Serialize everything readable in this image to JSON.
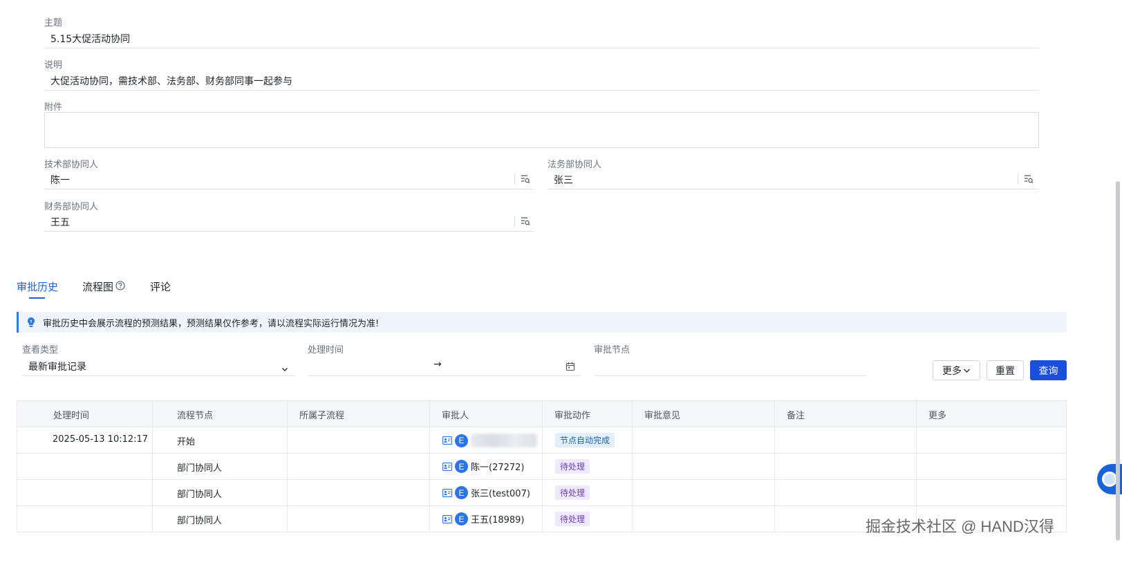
{
  "form": {
    "subject": {
      "label": "主题",
      "value": "5.15大促活动协同"
    },
    "description": {
      "label": "说明",
      "value": "大促活动协同，需技术部、法务部、财务部同事一起参与"
    },
    "attachment": {
      "label": "附件"
    },
    "tech_collab": {
      "label": "技术部协同人",
      "value": "陈一"
    },
    "legal_collab": {
      "label": "法务部协同人",
      "value": "张三"
    },
    "finance_collab": {
      "label": "财务部协同人",
      "value": "王五"
    }
  },
  "tabs": [
    {
      "label": "审批历史",
      "active": true
    },
    {
      "label": "流程图",
      "active": false
    },
    {
      "label": "评论",
      "active": false
    }
  ],
  "notice": "审批历史中会展示流程的预测结果，预测结果仅作参考，请以流程实际运行情况为准!",
  "filters": {
    "view_type": {
      "label": "查看类型",
      "value": "最新审批记录"
    },
    "process_time": {
      "label": "处理时间",
      "separator": "→"
    },
    "approval_node": {
      "label": "审批节点",
      "value": ""
    },
    "more_label": "更多",
    "reset_label": "重置",
    "query_label": "查询"
  },
  "table": {
    "headers": [
      "处理时间",
      "流程节点",
      "所属子流程",
      "审批人",
      "审批动作",
      "审批意见",
      "备注",
      "更多"
    ],
    "rows": [
      {
        "time": "2025-05-13 10:12:17",
        "node": "开始",
        "subprocess": "",
        "approver": "",
        "approver_blurred": true,
        "action": "节点自动完成",
        "action_type": "auto",
        "opinion": "",
        "remark": ""
      },
      {
        "time": "",
        "node": "部门协同人",
        "subprocess": "",
        "approver": "陈一(27272)",
        "approver_blurred": false,
        "action": "待处理",
        "action_type": "pending",
        "opinion": "",
        "remark": ""
      },
      {
        "time": "",
        "node": "部门协同人",
        "subprocess": "",
        "approver": "张三(test007)",
        "approver_blurred": false,
        "action": "待处理",
        "action_type": "pending",
        "opinion": "",
        "remark": ""
      },
      {
        "time": "",
        "node": "部门协同人",
        "subprocess": "",
        "approver": "王五(18989)",
        "approver_blurred": false,
        "action": "待处理",
        "action_type": "pending",
        "opinion": "",
        "remark": ""
      }
    ]
  },
  "avatar_letter": "E",
  "watermark": "掘金技术社区 @ HAND汉得",
  "colors": {
    "primary": "#1a4fdc",
    "tab_active": "#1a62d8",
    "notice_bg": "#eef5fd"
  }
}
